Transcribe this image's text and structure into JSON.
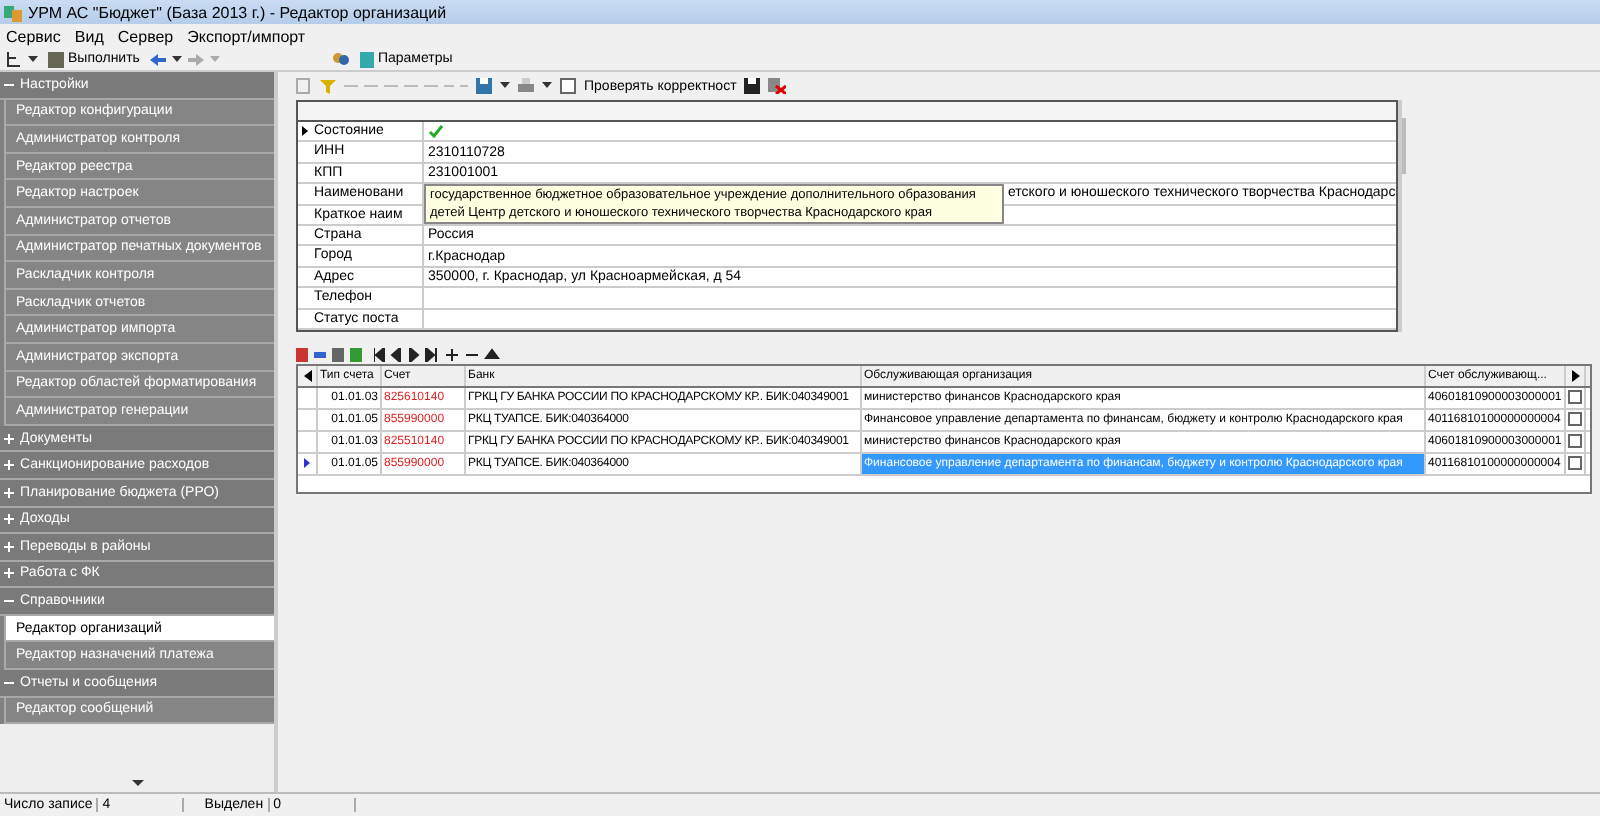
{
  "window": {
    "title": "УРМ АС \"Бюджет\" (База 2013 г.) - Редактор организаций"
  },
  "menu": [
    "Сервис",
    "Вид",
    "Сервер",
    "Экспорт/импорт"
  ],
  "toolbar": {
    "run_button": "Выполнить",
    "tab": "Параметры"
  },
  "sidebar": {
    "groups": [
      {
        "label": "Настройки",
        "expanded": true,
        "children": [
          {
            "label": "Редактор конфигурации",
            "selected": false
          },
          {
            "label": "Администратор контроля",
            "selected": false
          },
          {
            "label": "Редактор реестра",
            "selected": false
          },
          {
            "label": "Редактор настроек",
            "selected": false
          },
          {
            "label": "Администратор отчетов",
            "selected": false
          },
          {
            "label": "Администратор печатных документов",
            "selected": false
          },
          {
            "label": "Раскладчик контроля",
            "selected": false
          },
          {
            "label": "Раскладчик отчетов",
            "selected": false
          },
          {
            "label": "Администратор импорта",
            "selected": false
          },
          {
            "label": "Администратор экспорта",
            "selected": false
          },
          {
            "label": "Редактор областей форматирования",
            "selected": false
          },
          {
            "label": "Администратор генерации",
            "selected": false
          }
        ]
      },
      {
        "label": "Документы",
        "expanded": false
      },
      {
        "label": "Санкционирование расходов",
        "expanded": false
      },
      {
        "label": "Планирование бюджета (РРО)",
        "expanded": false
      },
      {
        "label": "Доходы",
        "expanded": false
      },
      {
        "label": "Переводы в районы",
        "expanded": false
      },
      {
        "label": "Работа с ФК",
        "expanded": false
      },
      {
        "label": "Справочники",
        "expanded": true,
        "children": [
          {
            "label": "Редактор организаций",
            "selected": true
          },
          {
            "label": "Редактор назначений платежа",
            "selected": false
          }
        ]
      },
      {
        "label": "Отчеты и сообщения",
        "expanded": true,
        "children": [
          {
            "label": "Редактор сообщений",
            "selected": false
          }
        ]
      }
    ]
  },
  "editor_toolbar": {
    "check_label": "Проверять корректност",
    "checked": false
  },
  "properties": [
    {
      "label": "Состояние",
      "kind": "check",
      "current": true
    },
    {
      "label": "ИНН",
      "value": "2310110728",
      "current": false
    },
    {
      "label": "КПП",
      "value": "231001001",
      "current": false
    },
    {
      "label": "Наименовани",
      "value": "етского и юношеского технического творчества Краснодарс",
      "tooltip": "государственное бюджетное образовательное учреждение дополнительного образования детей Центр детского и юношеского технического творчества Краснодарского края",
      "current": false
    },
    {
      "label": "Краткое наим",
      "current": false
    },
    {
      "label": "Страна",
      "value": "Россия",
      "current": false
    },
    {
      "label": "Город",
      "value": "г.Краснодар",
      "current": false
    },
    {
      "label": "Адрес",
      "value": "350000, г. Краснодар, ул Красноармейская, д 54",
      "current": false
    },
    {
      "label": "Телефон",
      "current": false
    },
    {
      "label": "Статус поста",
      "current": false
    }
  ],
  "table": {
    "columns": [
      "Тип счета",
      "Счет",
      "Банк",
      "Обслуживающая организация",
      "Счет обслуживающ..."
    ],
    "rows": [
      {
        "cells": [
          "01.01.03",
          "825610140",
          "ГРКЦ ГУ БАНКА РОССИИ ПО КРАСНОДАРСКОМУ КР.. БИК:040349001",
          "министерство финансов Краснодарского края",
          "40601810900003000001"
        ],
        "checked": false,
        "selected": false
      },
      {
        "cells": [
          "01.01.05",
          "855990000",
          "РКЦ ТУАПСЕ. БИК:040364000",
          "Финансовое управление департамента по финансам, бюджету и контролю Краснодарского края",
          "40116810100000000004"
        ],
        "checked": false,
        "selected": false
      },
      {
        "cells": [
          "01.01.03",
          "825510140",
          "ГРКЦ ГУ БАНКА РОССИИ ПО КРАСНОДАРСКОМУ КР.. БИК:040349001",
          "министерство финансов Краснодарского края",
          "40601810900003000001"
        ],
        "checked": false,
        "selected": false
      },
      {
        "cells": [
          "01.01.05",
          "855990000",
          "РКЦ ТУАПСЕ. БИК:040364000",
          "Финансовое управление департамента по финансам, бюджету и контролю Краснодарского края",
          "40116810100000000004"
        ],
        "checked": false,
        "selected": true
      }
    ]
  },
  "status_bar": {
    "records_label": "Число записе",
    "records": "4",
    "selected_label": "Выделен",
    "selected": "0"
  }
}
